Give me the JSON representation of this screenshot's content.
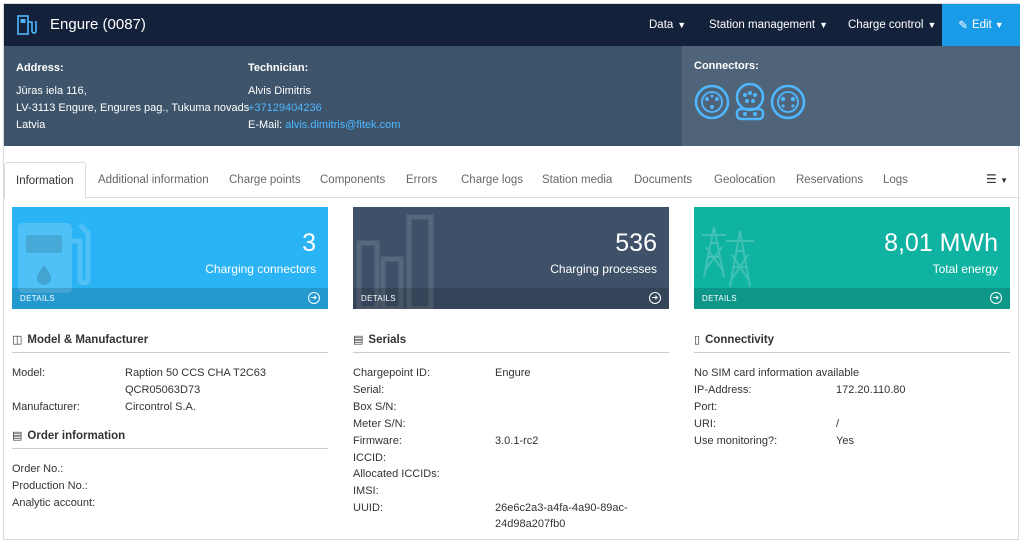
{
  "header": {
    "title": "Engure (0087)",
    "nav": [
      "Data",
      "Station management",
      "Charge control"
    ],
    "edit_label": "Edit"
  },
  "info": {
    "address_label": "Address:",
    "address_lines": [
      "Jūras iela 116,",
      "LV-3113 Engure, Engures pag., Tukuma novads",
      "Latvia"
    ],
    "technician_label": "Technician:",
    "technician_name": "Alvis Dimitris",
    "technician_phone": "+37129404236",
    "email_label": "E-Mail:",
    "email": "alvis.dimitris@fitek.com",
    "connectors_label": "Connectors:",
    "connector_icons": [
      "type2-connector-icon",
      "ccs-connector-icon",
      "chademo-connector-icon"
    ]
  },
  "tabs": [
    "Information",
    "Additional information",
    "Charge points",
    "Components",
    "Errors",
    "Charge logs",
    "Station media",
    "Documents",
    "Geolocation",
    "Reservations",
    "Logs"
  ],
  "cards": [
    {
      "value": "3",
      "caption": "Charging connectors",
      "footer": "DETAILS",
      "color": "#2ab4f5"
    },
    {
      "value": "536",
      "caption": "Charging processes",
      "footer": "DETAILS",
      "color": "#3f5169"
    },
    {
      "value": "8,01 MWh",
      "caption": "Total energy",
      "footer": "DETAILS",
      "color": "#10b2a2"
    }
  ],
  "model": {
    "heading": "Model & Manufacturer",
    "model_label": "Model:",
    "model_value": "Raption 50 CCS CHA T2C63",
    "model_code": "QCR05063D73",
    "manufacturer_label": "Manufacturer:",
    "manufacturer_value": "Circontrol S.A."
  },
  "order": {
    "heading": "Order information",
    "rows": [
      "Order No.:",
      "Production No.:",
      "Analytic account:"
    ]
  },
  "serials": {
    "heading": "Serials",
    "rows": [
      {
        "label": "Chargepoint ID:",
        "value": "Engure"
      },
      {
        "label": "Serial:",
        "value": ""
      },
      {
        "label": "Box S/N:",
        "value": ""
      },
      {
        "label": "Meter S/N:",
        "value": ""
      },
      {
        "label": "Firmware:",
        "value": "3.0.1-rc2"
      },
      {
        "label": "ICCID:",
        "value": ""
      },
      {
        "label": "Allocated ICCIDs:",
        "value": ""
      },
      {
        "label": "IMSI:",
        "value": ""
      },
      {
        "label": "UUID:",
        "value": "26e6c2a3-a4fa-4a90-89ac-"
      }
    ],
    "uuid_cont": "24d98a207fb0"
  },
  "connectivity": {
    "heading": "Connectivity",
    "sim_note": "No SIM card information available",
    "rows": [
      {
        "label": "IP-Address:",
        "value": "172.20.110.80"
      },
      {
        "label": "Port:",
        "value": ""
      },
      {
        "label": "URI:",
        "value": "/"
      },
      {
        "label": "Use monitoring?:",
        "value": "Yes"
      }
    ]
  }
}
